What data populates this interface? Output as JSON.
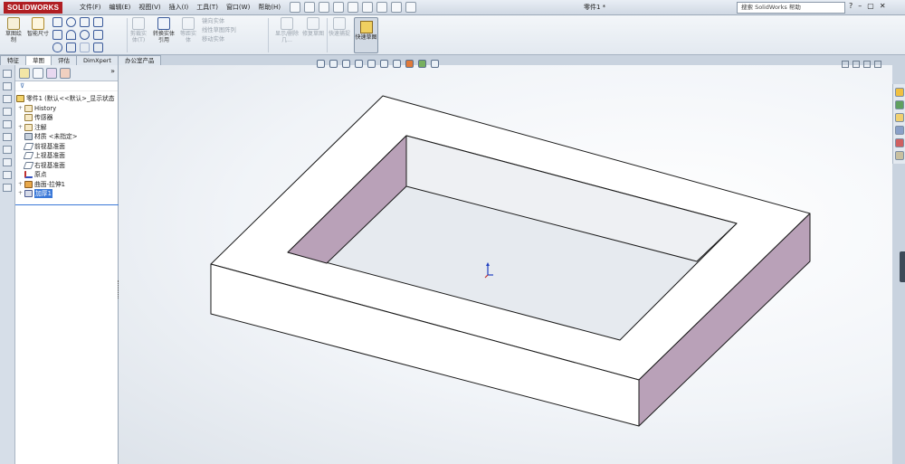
{
  "app": {
    "logo_text": "SOLIDWORKS",
    "doc_title": "零件1 *",
    "search_placeholder": "搜索 SolidWorks 帮助",
    "window_buttons": [
      "?",
      "–",
      "▢",
      "✕"
    ]
  },
  "menu": [
    "文件(F)",
    "编辑(E)",
    "视图(V)",
    "插入(I)",
    "工具(T)",
    "窗口(W)",
    "帮助(H)"
  ],
  "toolbar": {
    "sketch_label": "草图绘制",
    "smart_dim_label": "智能尺寸",
    "trim_label": "剪裁实体(T)",
    "convert_label": "转换实体引用",
    "offset_label": "等距实体",
    "mirror_label": "镜向实体",
    "linear_pattern_label": "线性草图阵列",
    "move_label": "移动实体",
    "display_delete_label": "显示/删除几...",
    "repair_label": "修复草图",
    "quick_snap_label": "快速捕捉",
    "rapid_sketch_label": "快速草图"
  },
  "tabs": [
    "特征",
    "草图",
    "评估",
    "DimXpert",
    "办公室产品"
  ],
  "tree": {
    "root": "零件1 (默认<<默认>_显示状态",
    "items": [
      {
        "label": "History",
        "expand": "+"
      },
      {
        "label": "传感器",
        "expand": ""
      },
      {
        "label": "注解",
        "expand": "+"
      },
      {
        "label": "材质 <未指定>",
        "expand": ""
      },
      {
        "label": "前视基准面",
        "expand": ""
      },
      {
        "label": "上视基准面",
        "expand": ""
      },
      {
        "label": "右视基准面",
        "expand": ""
      },
      {
        "label": "原点",
        "expand": ""
      },
      {
        "label": "曲面-拉伸1",
        "expand": "+"
      },
      {
        "label": "加厚1",
        "expand": "+"
      }
    ]
  },
  "colors": {
    "face_top": "#ffffff",
    "face_side": "#b9a1b8",
    "edge": "#1a1a1a",
    "selection": "#3a78d8"
  }
}
